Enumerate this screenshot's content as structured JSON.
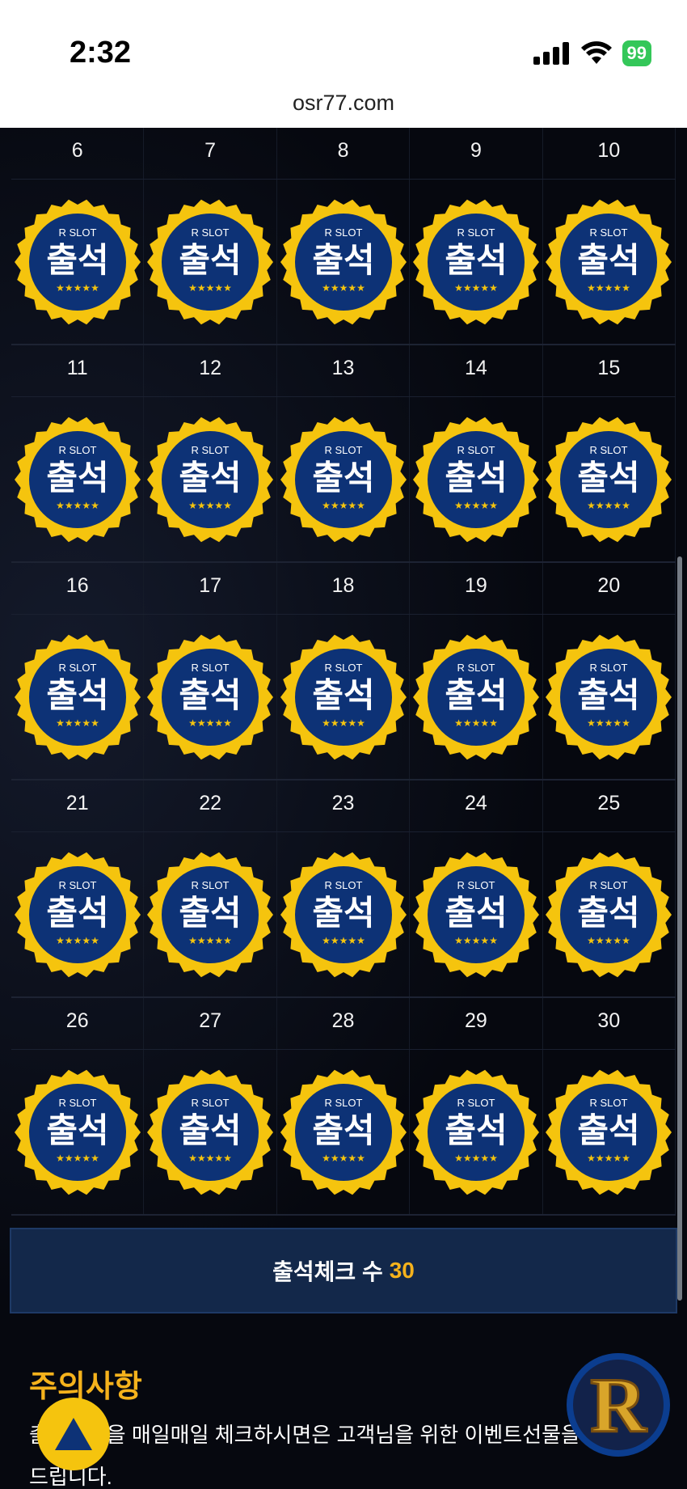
{
  "status_bar": {
    "time": "2:32",
    "battery": "99",
    "icons": [
      "signal-icon",
      "wifi-icon",
      "battery-icon"
    ]
  },
  "browser": {
    "url": "osr77.com"
  },
  "badge": {
    "brand": "R SLOT",
    "text": "출석",
    "stars": "★★★★★",
    "colors": {
      "outer": "#f5c40e",
      "inner": "#0d3276",
      "stars": "#f5c40e"
    }
  },
  "calendar": {
    "rows": [
      [
        "6",
        "7",
        "8",
        "9",
        "10"
      ],
      [
        "11",
        "12",
        "13",
        "14",
        "15"
      ],
      [
        "16",
        "17",
        "18",
        "19",
        "20"
      ],
      [
        "21",
        "22",
        "23",
        "24",
        "25"
      ],
      [
        "26",
        "27",
        "28",
        "29",
        "30"
      ]
    ]
  },
  "attendance": {
    "label": "출석체크 수",
    "count": "30"
  },
  "notice": {
    "title": "주의사항",
    "text": "출석도장을 매일매일 체크하시면은 고객님을 위한 이벤트선물을 드립니다."
  },
  "colors": {
    "accent": "#f5b21c",
    "bar": "#13284a",
    "background": "#05070f"
  }
}
